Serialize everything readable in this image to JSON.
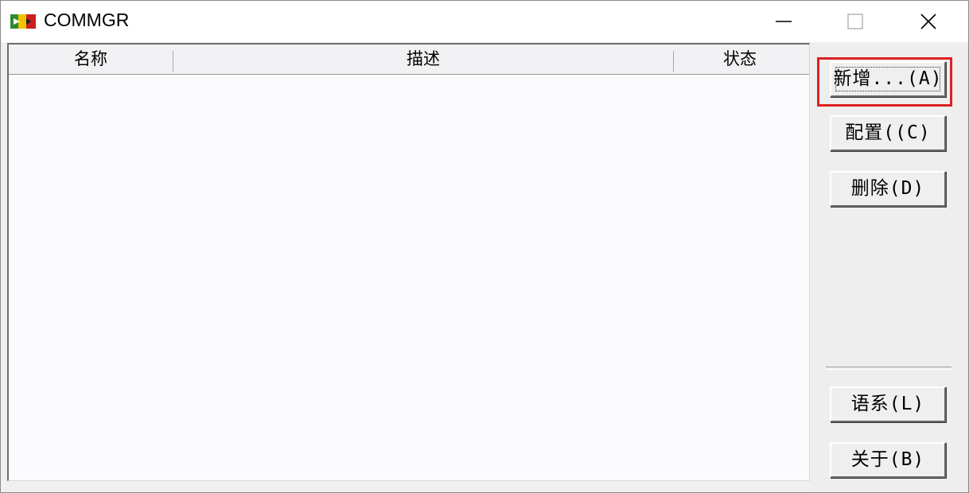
{
  "window": {
    "title": "COMMGR",
    "controls": {
      "minimize": "minimize-icon",
      "maximize": "maximize-icon",
      "close": "close-icon"
    }
  },
  "list": {
    "columns": [
      "名称",
      "描述",
      "状态"
    ],
    "rows": []
  },
  "buttons": {
    "add": "新增...(A)",
    "config": "配置((C)",
    "delete": "删除(D)",
    "language": "语系(L)",
    "about": "关于(B)"
  },
  "colors": {
    "highlight": "#e02020"
  }
}
